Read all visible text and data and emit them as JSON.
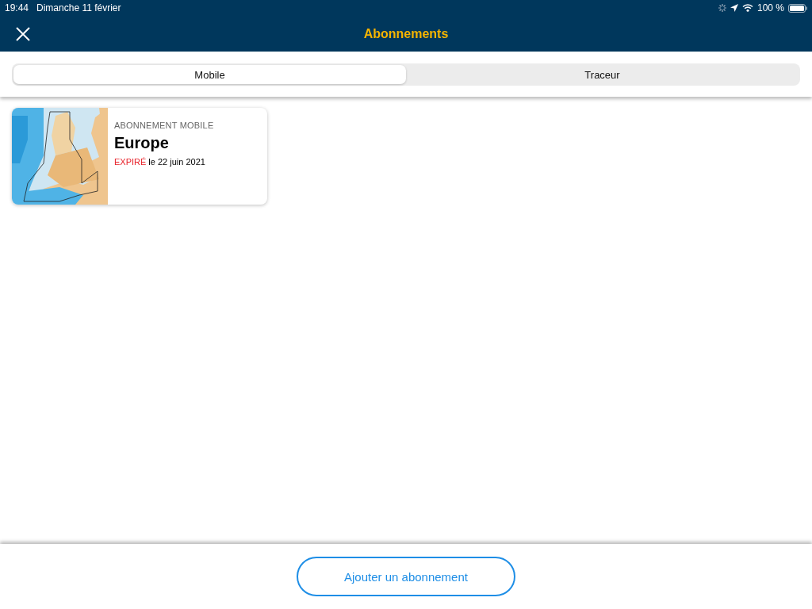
{
  "status_bar": {
    "time": "19:44",
    "date": "Dimanche 11 février",
    "battery": "100 %"
  },
  "header": {
    "title": "Abonnements"
  },
  "tabs": [
    {
      "label": "Mobile",
      "selected": true
    },
    {
      "label": "Traceur",
      "selected": false
    }
  ],
  "subscriptions": [
    {
      "kind": "picture",
      "category": "ABONNEMENT MOBILE",
      "name": "Europe",
      "status": {
        "label": "EXPIRÉ",
        "kind": "expired"
      },
      "date": "le 22 juin 2021"
    }
  ],
  "footer": {
    "button": "Ajouter un abonnement"
  }
}
